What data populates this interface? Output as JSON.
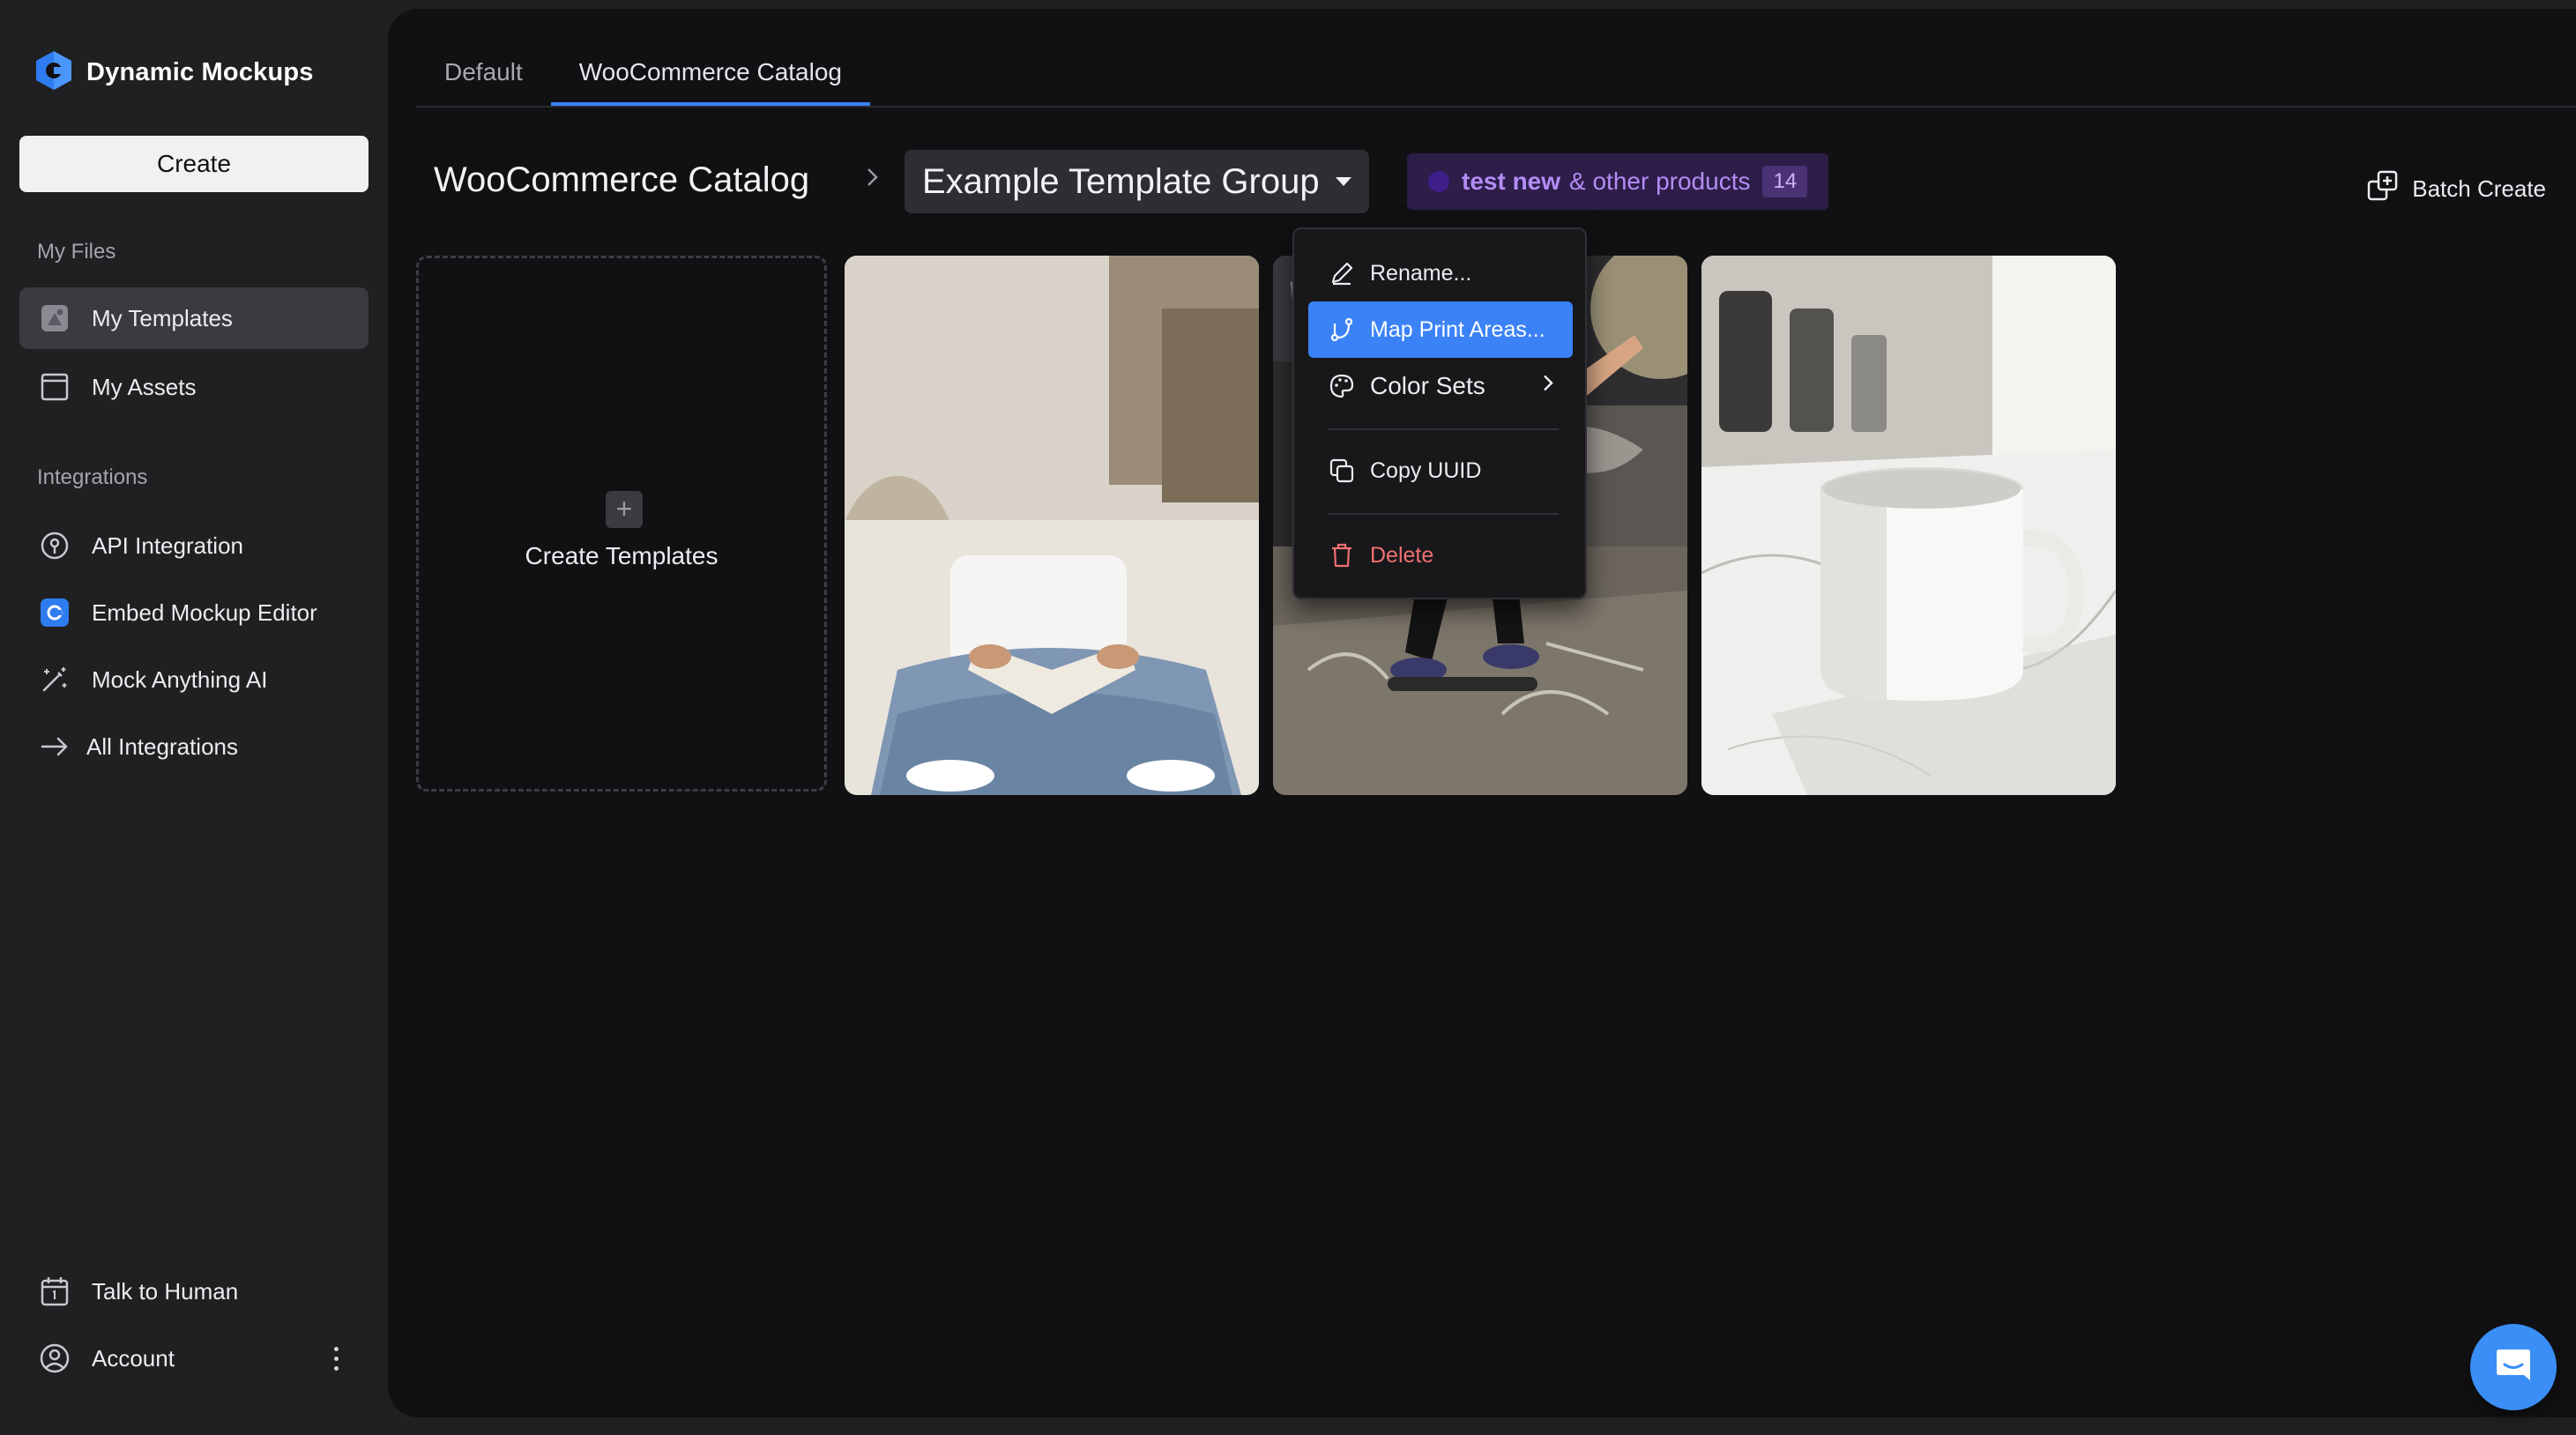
{
  "app": {
    "brand": "Dynamic Mockups",
    "colors": {
      "accent": "#3b82f6",
      "danger": "#f07070",
      "badge_bg": "#2c1d49",
      "badge_text": "#b48cf5"
    }
  },
  "sidebar": {
    "create_label": "Create",
    "my_files_label": "My Files",
    "my_files": [
      {
        "label": "My Templates",
        "icon": "templates-icon",
        "active": true
      },
      {
        "label": "My Assets",
        "icon": "folder-icon",
        "active": false
      }
    ],
    "integrations_label": "Integrations",
    "integrations": [
      {
        "label": "API Integration",
        "icon": "api-icon"
      },
      {
        "label": "Embed Mockup Editor",
        "icon": "embed-icon"
      },
      {
        "label": "Mock Anything AI",
        "icon": "magic-wand-icon"
      },
      {
        "label": "All Integrations",
        "icon": "arrow-right-icon"
      }
    ],
    "bottom": [
      {
        "label": "Talk to Human",
        "icon": "calendar-icon"
      },
      {
        "label": "Account",
        "icon": "user-circle-icon"
      }
    ]
  },
  "tabs": [
    {
      "label": "Default",
      "active": false
    },
    {
      "label": "WooCommerce Catalog",
      "active": true
    }
  ],
  "header": {
    "catalog": "WooCommerce Catalog",
    "group": "Example Template Group",
    "product_badge": {
      "strong": "test new",
      "rest": "& other products",
      "count": "14"
    },
    "batch_create": "Batch Create"
  },
  "grid": {
    "create_label": "Create Templates",
    "create_plus": "+"
  },
  "context_menu": {
    "items": [
      {
        "label": "Rename...",
        "icon": "pencil-icon"
      },
      {
        "label": "Map Print Areas...",
        "icon": "map-print-areas-icon",
        "highlighted": true
      },
      {
        "label": "Color Sets",
        "icon": "palette-icon",
        "has_submenu": true
      },
      {
        "label": "Copy UUID",
        "icon": "copy-icon"
      },
      {
        "label": "Delete",
        "icon": "trash-icon",
        "danger": true
      }
    ]
  }
}
